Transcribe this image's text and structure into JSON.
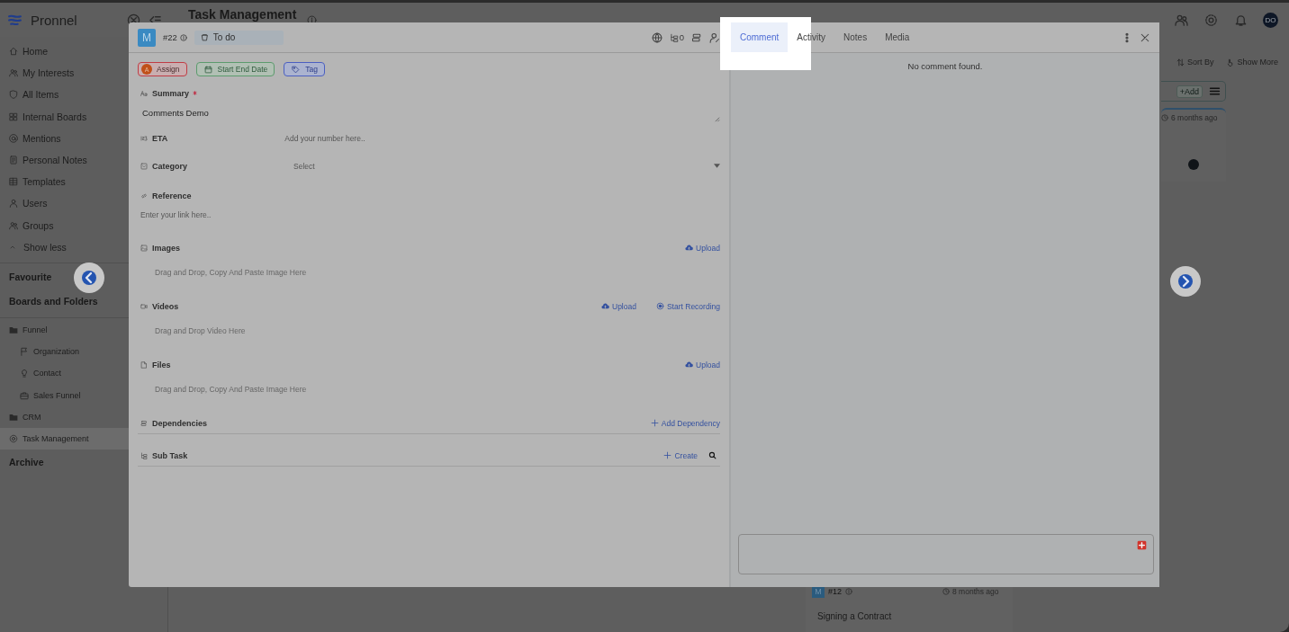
{
  "app": {
    "logo": "Pronnel",
    "page_title": "Task Management",
    "avatar": "DO"
  },
  "sidebar": {
    "items": [
      {
        "label": "Home"
      },
      {
        "label": "My Interests"
      },
      {
        "label": "All Items"
      },
      {
        "label": "Internal Boards"
      },
      {
        "label": "Mentions"
      },
      {
        "label": "Personal Notes"
      },
      {
        "label": "Templates"
      },
      {
        "label": "Users"
      },
      {
        "label": "Groups"
      }
    ],
    "toggle": "Show less",
    "sections": [
      "Favourite",
      "Boards and Folders"
    ],
    "boards": [
      {
        "kind": "folder",
        "label": "Funnel",
        "selected": false,
        "children": [
          {
            "kind": "board",
            "label": "Organization",
            "selected": false
          },
          {
            "kind": "board",
            "label": "Contact",
            "selected": false
          },
          {
            "kind": "board",
            "label": "Sales Funnel",
            "selected": false
          }
        ]
      },
      {
        "kind": "folder",
        "label": "CRM",
        "selected": false
      },
      {
        "kind": "board",
        "label": "Task Management",
        "selected": true
      }
    ],
    "archive": "Archive"
  },
  "board": {
    "toolbar": [
      {
        "kind": "sort",
        "label": "Sort By"
      },
      {
        "kind": "more",
        "label": "Show More"
      }
    ],
    "add_button": "+Add",
    "cards": [
      {
        "time": "6 months ago"
      },
      {
        "avatar": "M",
        "id": "#12",
        "time": "8 months ago",
        "title": "Signing a Contract"
      }
    ]
  },
  "modal": {
    "task": {
      "avatar": "M",
      "id": "#22",
      "status": "To do",
      "subtask_count": "0"
    },
    "chips": [
      {
        "kind": "assign",
        "avatar": "A",
        "label": "Assign"
      },
      {
        "kind": "date",
        "label": "Start End Date"
      },
      {
        "kind": "tag",
        "label": "Tag"
      }
    ],
    "fields": [
      {
        "kind": "text",
        "label": "Summary",
        "required": true,
        "value": "Comments Demo"
      },
      {
        "kind": "inline",
        "label": "ETA",
        "placeholder": "Add your number here.."
      },
      {
        "kind": "select",
        "label": "Category",
        "placeholder": "Select"
      },
      {
        "kind": "link",
        "label": "Reference",
        "placeholder": "Enter your link here.."
      },
      {
        "kind": "media",
        "label": "Images",
        "actions": [
          {
            "kind": "upload",
            "label": "Upload"
          }
        ],
        "hint": "Drag and Drop, Copy And Paste Image Here"
      },
      {
        "kind": "media",
        "label": "Videos",
        "actions": [
          {
            "kind": "upload",
            "label": "Upload"
          },
          {
            "kind": "record",
            "label": "Start Recording"
          }
        ],
        "hint": "Drag and Drop Video Here"
      },
      {
        "kind": "media",
        "label": "Files",
        "actions": [
          {
            "kind": "upload",
            "label": "Upload"
          }
        ],
        "hint": "Drag and Drop, Copy And Paste Image Here"
      },
      {
        "kind": "list",
        "label": "Dependencies",
        "actions": [
          {
            "kind": "add",
            "label": "Add Dependency"
          }
        ]
      },
      {
        "kind": "list",
        "label": "Sub Task",
        "actions": [
          {
            "kind": "add",
            "label": "Create"
          },
          {
            "kind": "search"
          }
        ]
      }
    ],
    "tabs": [
      {
        "label": "Comment",
        "selected": true,
        "spotlight": true
      },
      {
        "label": "Activity",
        "selected": false,
        "spotlight": false
      },
      {
        "label": "Notes",
        "selected": false,
        "spotlight": false
      },
      {
        "label": "Media",
        "selected": false,
        "spotlight": false
      }
    ],
    "empty_text": "No comment found."
  }
}
